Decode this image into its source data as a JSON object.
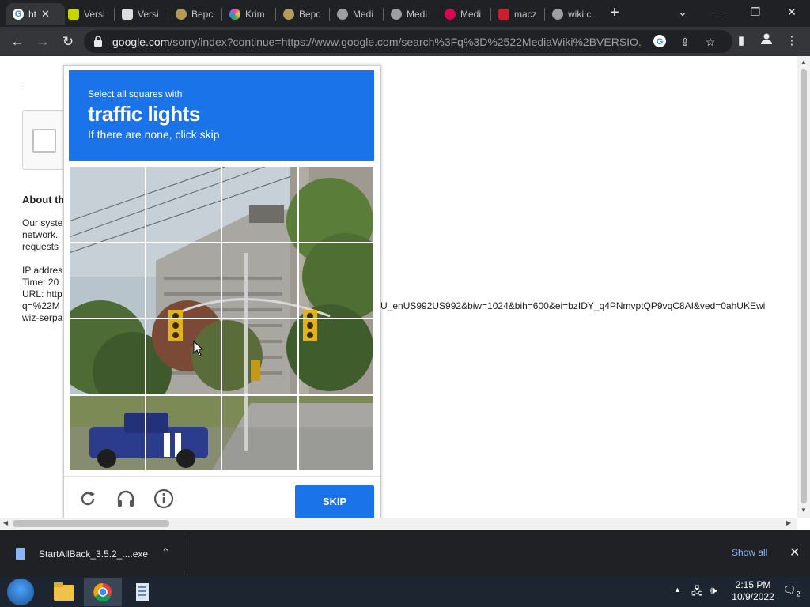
{
  "tabs": [
    {
      "label": "ht",
      "favicon": "google-icon",
      "color": "#4285f4",
      "active": true
    },
    {
      "label": "Versi",
      "favicon": "versi-icon",
      "color": "#c8d400"
    },
    {
      "label": "Versi",
      "favicon": "mediawiki-n-icon",
      "color": "#dddddd"
    },
    {
      "label": "Верс",
      "favicon": "ornament-icon",
      "color": "#b59a5a"
    },
    {
      "label": "Krim",
      "favicon": "colorwheel-icon",
      "color": "#e64a9d"
    },
    {
      "label": "Верс",
      "favicon": "ornament-icon",
      "color": "#b59a5a"
    },
    {
      "label": "Medi",
      "favicon": "globe-icon",
      "color": "#9aa0a6"
    },
    {
      "label": "Medi",
      "favicon": "globe-icon",
      "color": "#9aa0a6"
    },
    {
      "label": "Medi",
      "favicon": "debian-icon",
      "color": "#d70751"
    },
    {
      "label": "macz",
      "favicon": "macz-icon",
      "color": "#cc1f2e"
    },
    {
      "label": "wiki.c",
      "favicon": "globe-icon",
      "color": "#9aa0a6"
    }
  ],
  "toolbar": {
    "url_domain": "google.com",
    "url_path": "/sorry/index?continue=https://www.google.com/search%3Fq%3D%2522MediaWiki%2BVERSIO..."
  },
  "page": {
    "about_heading": "About th",
    "para_lines": [
      "Our syste",
      "network.",
      "requests"
    ],
    "info_lines": [
      "IP addres",
      "Time: 20",
      "URL: http",
      "q=%22M",
      "wiz-serpa"
    ],
    "url_tail": "U_enUS992US992&biw=1024&bih=600&ei=bzIDY_q4PNmvptQP9vqC8AI&ved=0ahUKEwi"
  },
  "captcha": {
    "line1": "Select all squares with",
    "target": "traffic lights",
    "line3": "If there are none, click skip",
    "skip_label": "SKIP",
    "colors": {
      "header": "#1a73e8"
    }
  },
  "download": {
    "filename": "StartAllBack_3.5.2_....exe",
    "show_all": "Show all"
  },
  "taskbar": {
    "time": "2:15 PM",
    "date": "10/9/2022",
    "notifications": "2"
  }
}
